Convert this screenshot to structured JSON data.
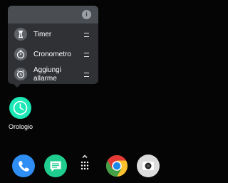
{
  "shortcuts_menu": {
    "info_icon": "info-icon",
    "items": [
      {
        "label": "Timer",
        "icon": "hourglass-icon"
      },
      {
        "label": "Cronometro",
        "icon": "stopwatch-icon"
      },
      {
        "label": "Aggiungi allarme",
        "icon": "alarm-clock-icon"
      }
    ]
  },
  "home_app": {
    "label": "Orologio",
    "icon": "clock-icon",
    "color": "#1de9b6"
  },
  "dock": {
    "apps": [
      {
        "icon": "phone-icon",
        "color": "#2f8ef4"
      },
      {
        "icon": "messages-icon",
        "color": "#1fce8f"
      },
      {
        "icon": "app-drawer-icon"
      },
      {
        "icon": "chrome-icon"
      },
      {
        "icon": "camera-icon",
        "color": "#dcdcdc"
      }
    ]
  },
  "colors": {
    "background": "#050505",
    "popup": "#2f3134",
    "popup_header": "#4a4d51"
  }
}
